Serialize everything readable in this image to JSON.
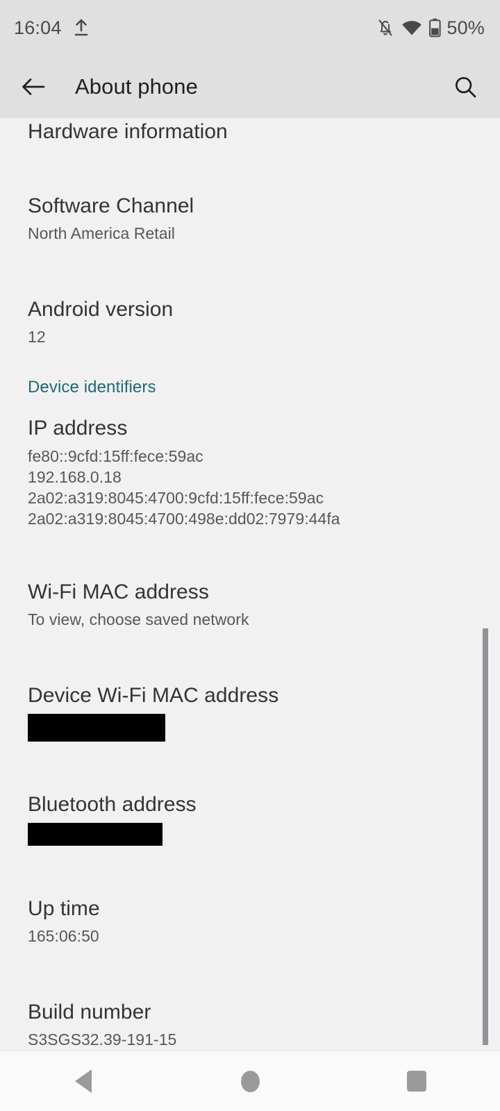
{
  "status_bar": {
    "time": "16:04",
    "upload_icon": "upload-icon",
    "notifications_muted_icon": "bell-off-icon",
    "wifi_icon": "wifi-icon",
    "battery_icon": "battery-half-icon",
    "battery_percent": "50%"
  },
  "app_bar": {
    "back_icon": "arrow-left-icon",
    "title": "About phone",
    "search_icon": "search-icon"
  },
  "content": {
    "items": [
      {
        "name": "hardware-information",
        "title": "Hardware information",
        "summary": null
      },
      {
        "name": "software-channel",
        "title": "Software Channel",
        "summary": "North America Retail"
      },
      {
        "name": "android-version",
        "title": "Android version",
        "summary": "12"
      }
    ],
    "section_header": "Device identifiers",
    "ip_address": {
      "title": "IP address",
      "values": [
        "fe80::9cfd:15ff:fece:59ac",
        "192.168.0.18",
        "2a02:a319:8045:4700:9cfd:15ff:fece:59ac",
        "2a02:a319:8045:4700:498e:dd02:7979:44fa"
      ]
    },
    "wifi_mac": {
      "title": "Wi-Fi MAC address",
      "summary": "To view, choose saved network"
    },
    "device_wifi_mac": {
      "title": "Device Wi-Fi MAC address",
      "summary_redacted": true
    },
    "bluetooth_address": {
      "title": "Bluetooth address",
      "summary_redacted": true
    },
    "up_time": {
      "title": "Up time",
      "summary": "165:06:50"
    },
    "build_number": {
      "title": "Build number",
      "summary": "S3SGS32.39-191-15"
    }
  },
  "nav_bar": {
    "back_icon": "nav-back-triangle-icon",
    "home_icon": "nav-home-circle-icon",
    "recents_icon": "nav-recents-square-icon"
  },
  "colors": {
    "status_bar_bg": "#e0e0e0",
    "app_bar_bg": "#e0e0e0",
    "content_bg": "#f1f1f1",
    "nav_bar_bg": "#fafafa",
    "title_text": "#313438",
    "summary_text": "#55585c",
    "section_accent": "#1c6b71",
    "redaction": "#000000",
    "scrollbar": "#8f9296",
    "nav_icon": "#9a9a9a"
  }
}
